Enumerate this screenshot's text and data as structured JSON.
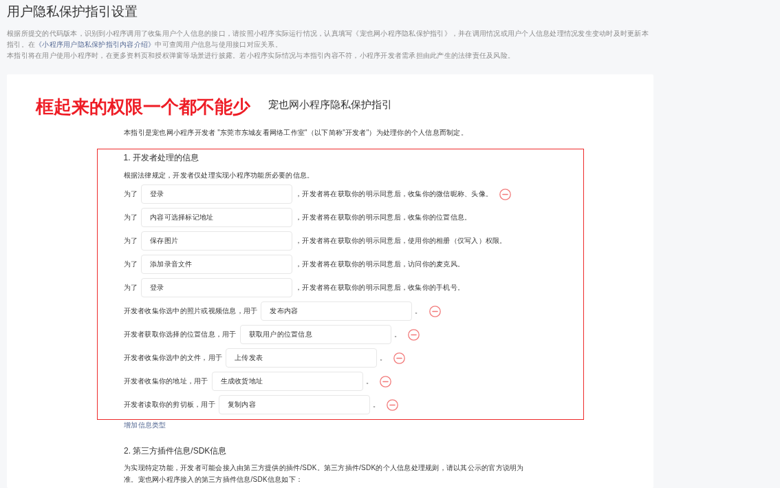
{
  "page": {
    "title": "用户隐私保护指引设置"
  },
  "intro": {
    "text_before": "根据所提交的代码版本，识别到小程序调用了收集用户个人信息的接口，请按照小程序实际运行情况，认真填写《宠也网小程序隐私保护指引》，并在调用情况或用户个人信息处理情况发生变动时及时更新本指引。在",
    "link": "《小程序用户隐私保护指引内容介绍》",
    "text_after": "中可查阅用户信息与使用接口对应关系。",
    "note": "本指引将在用户使用小程序时，在更多资料页和授权弹窗等场景进行披露。若小程序实际情况与本指引内容不符，小程序开发者需承担由此产生的法律责任及风险。"
  },
  "annotation": {
    "label": "框起来的权限一个都不能少"
  },
  "guide": {
    "title": "宠也网小程序隐私保护指引",
    "preamble": "本指引是宠也网小程序开发者 \"东莞市东城友看网络工作室\"（以下简称\"开发者\"）为处理你的个人信息而制定。",
    "sections": [
      {
        "heading": "1. 开发者处理的信息",
        "description": "根据法律规定，开发者仅处理实现小程序功能所必要的信息。",
        "highlighted": true,
        "items": [
          {
            "prefix": "为了",
            "value": "登录",
            "suffix": "，开发者将在获取你的明示同意后，收集你的微信昵称、头像。",
            "removable": true
          },
          {
            "prefix": "为了",
            "value": "内容可选择标记地址",
            "suffix": "，开发者将在获取你的明示同意后，收集你的位置信息。",
            "removable": false
          },
          {
            "prefix": "为了",
            "value": "保存图片",
            "suffix": "，开发者将在获取你的明示同意后，使用你的相册（仅写入）权限。",
            "removable": false
          },
          {
            "prefix": "为了",
            "value": "添加录音文件",
            "suffix": "，开发者将在获取你的明示同意后，访问你的麦克风。",
            "removable": false
          },
          {
            "prefix": "为了",
            "value": "登录",
            "suffix": "，开发者将在获取你的明示同意后，收集你的手机号。",
            "removable": false
          },
          {
            "prefix": "开发者收集你选中的照片或视频信息，用于",
            "value": "发布内容",
            "suffix": "。",
            "removable": true
          },
          {
            "prefix": "开发者获取你选择的位置信息，用于",
            "value": "获取用户的位置信息",
            "suffix": "。",
            "removable": true
          },
          {
            "prefix": "开发者收集你选中的文件，用于",
            "value": "上传发表",
            "suffix": "。",
            "removable": true
          },
          {
            "prefix": "开发者收集你的地址，用于",
            "value": "生成收货地址",
            "suffix": "。",
            "removable": true
          },
          {
            "prefix": "开发者读取你的剪切板，用于",
            "value": "复制内容",
            "suffix": "。",
            "removable": true
          }
        ],
        "add_link": "增加信息类型"
      },
      {
        "heading": "2. 第三方插件信息/SDK信息",
        "description": "为实现特定功能，开发者可能会接入由第三方提供的插件/SDK。第三方插件/SDK的个人信息处理规则，请以其公示的官方说明为准。宠也网小程序接入的第三方插件信息/SDK信息如下：",
        "highlighted": false
      }
    ]
  }
}
